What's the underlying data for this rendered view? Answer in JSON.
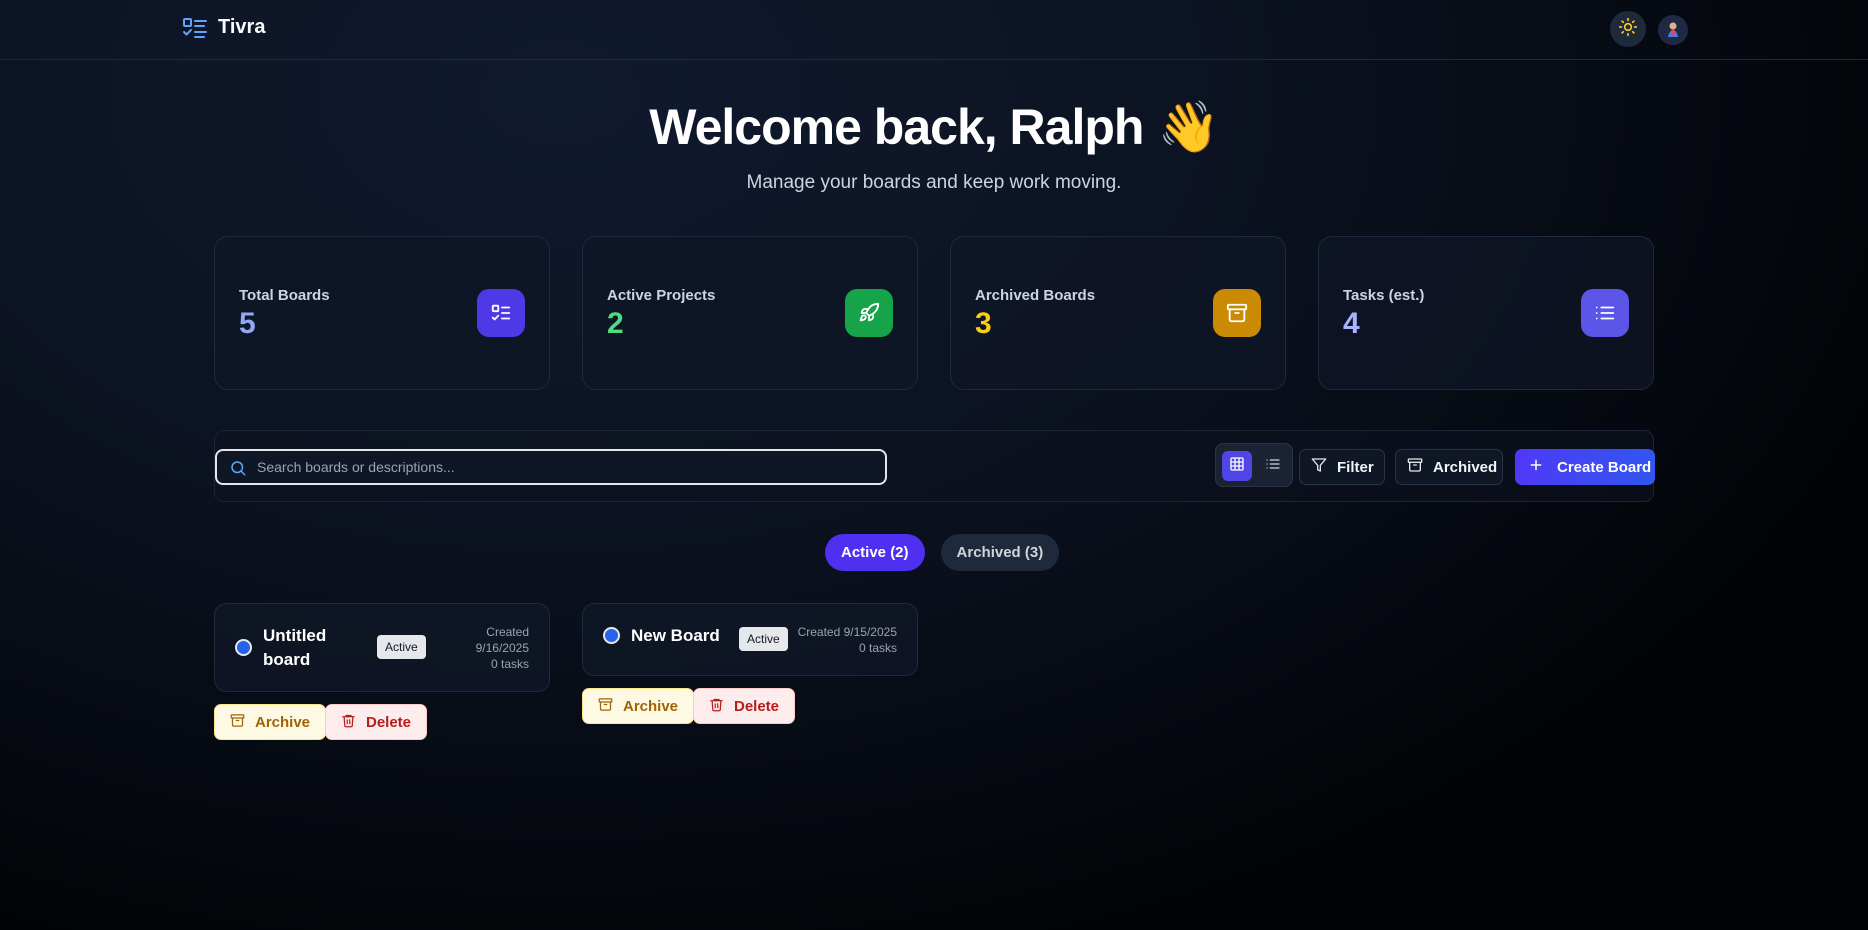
{
  "header": {
    "brand": "Tivra",
    "logo_icon": "checklist-icon",
    "theme_icon": "sun-icon",
    "avatar_icon": "avatar"
  },
  "hero": {
    "title": "Welcome back, Ralph",
    "emoji": "👋",
    "subtitle": "Manage your boards and keep work moving."
  },
  "stats": [
    {
      "label": "Total Boards",
      "value": "5",
      "value_color": "#93a5f5",
      "icon": "checklist-icon",
      "icon_bg": "#4f39e6"
    },
    {
      "label": "Active Projects",
      "value": "2",
      "value_color": "#4ade80",
      "icon": "rocket-icon",
      "icon_bg": "#16a34a"
    },
    {
      "label": "Archived Boards",
      "value": "3",
      "value_color": "#facc15",
      "icon": "archive-icon",
      "icon_bg": "#ca8a04"
    },
    {
      "label": "Tasks (est.)",
      "value": "4",
      "value_color": "#a5b4fc",
      "icon": "list-icon",
      "icon_bg": "#5b56e8"
    }
  ],
  "toolbar": {
    "search_placeholder": "Search boards or descriptions...",
    "filter_label": "Filter",
    "archived_label": "Archived",
    "create_label": "Create Board"
  },
  "tabs": [
    {
      "label": "Active (2)",
      "active": true
    },
    {
      "label": "Archived (3)",
      "active": false
    }
  ],
  "boards": [
    {
      "name_line1": "Untitled",
      "name_line2": "board",
      "status": "Active",
      "created_line1": "Created",
      "created_line2": "9/16/2025",
      "tasks": "0 tasks",
      "archive_label": "Archive",
      "delete_label": "Delete"
    },
    {
      "name": "New Board",
      "status": "Active",
      "created": "Created 9/15/2025",
      "tasks": "0 tasks",
      "archive_label": "Archive",
      "delete_label": "Delete"
    }
  ],
  "colors": {
    "accent": "#4f39f6",
    "background": "#0c1322"
  }
}
